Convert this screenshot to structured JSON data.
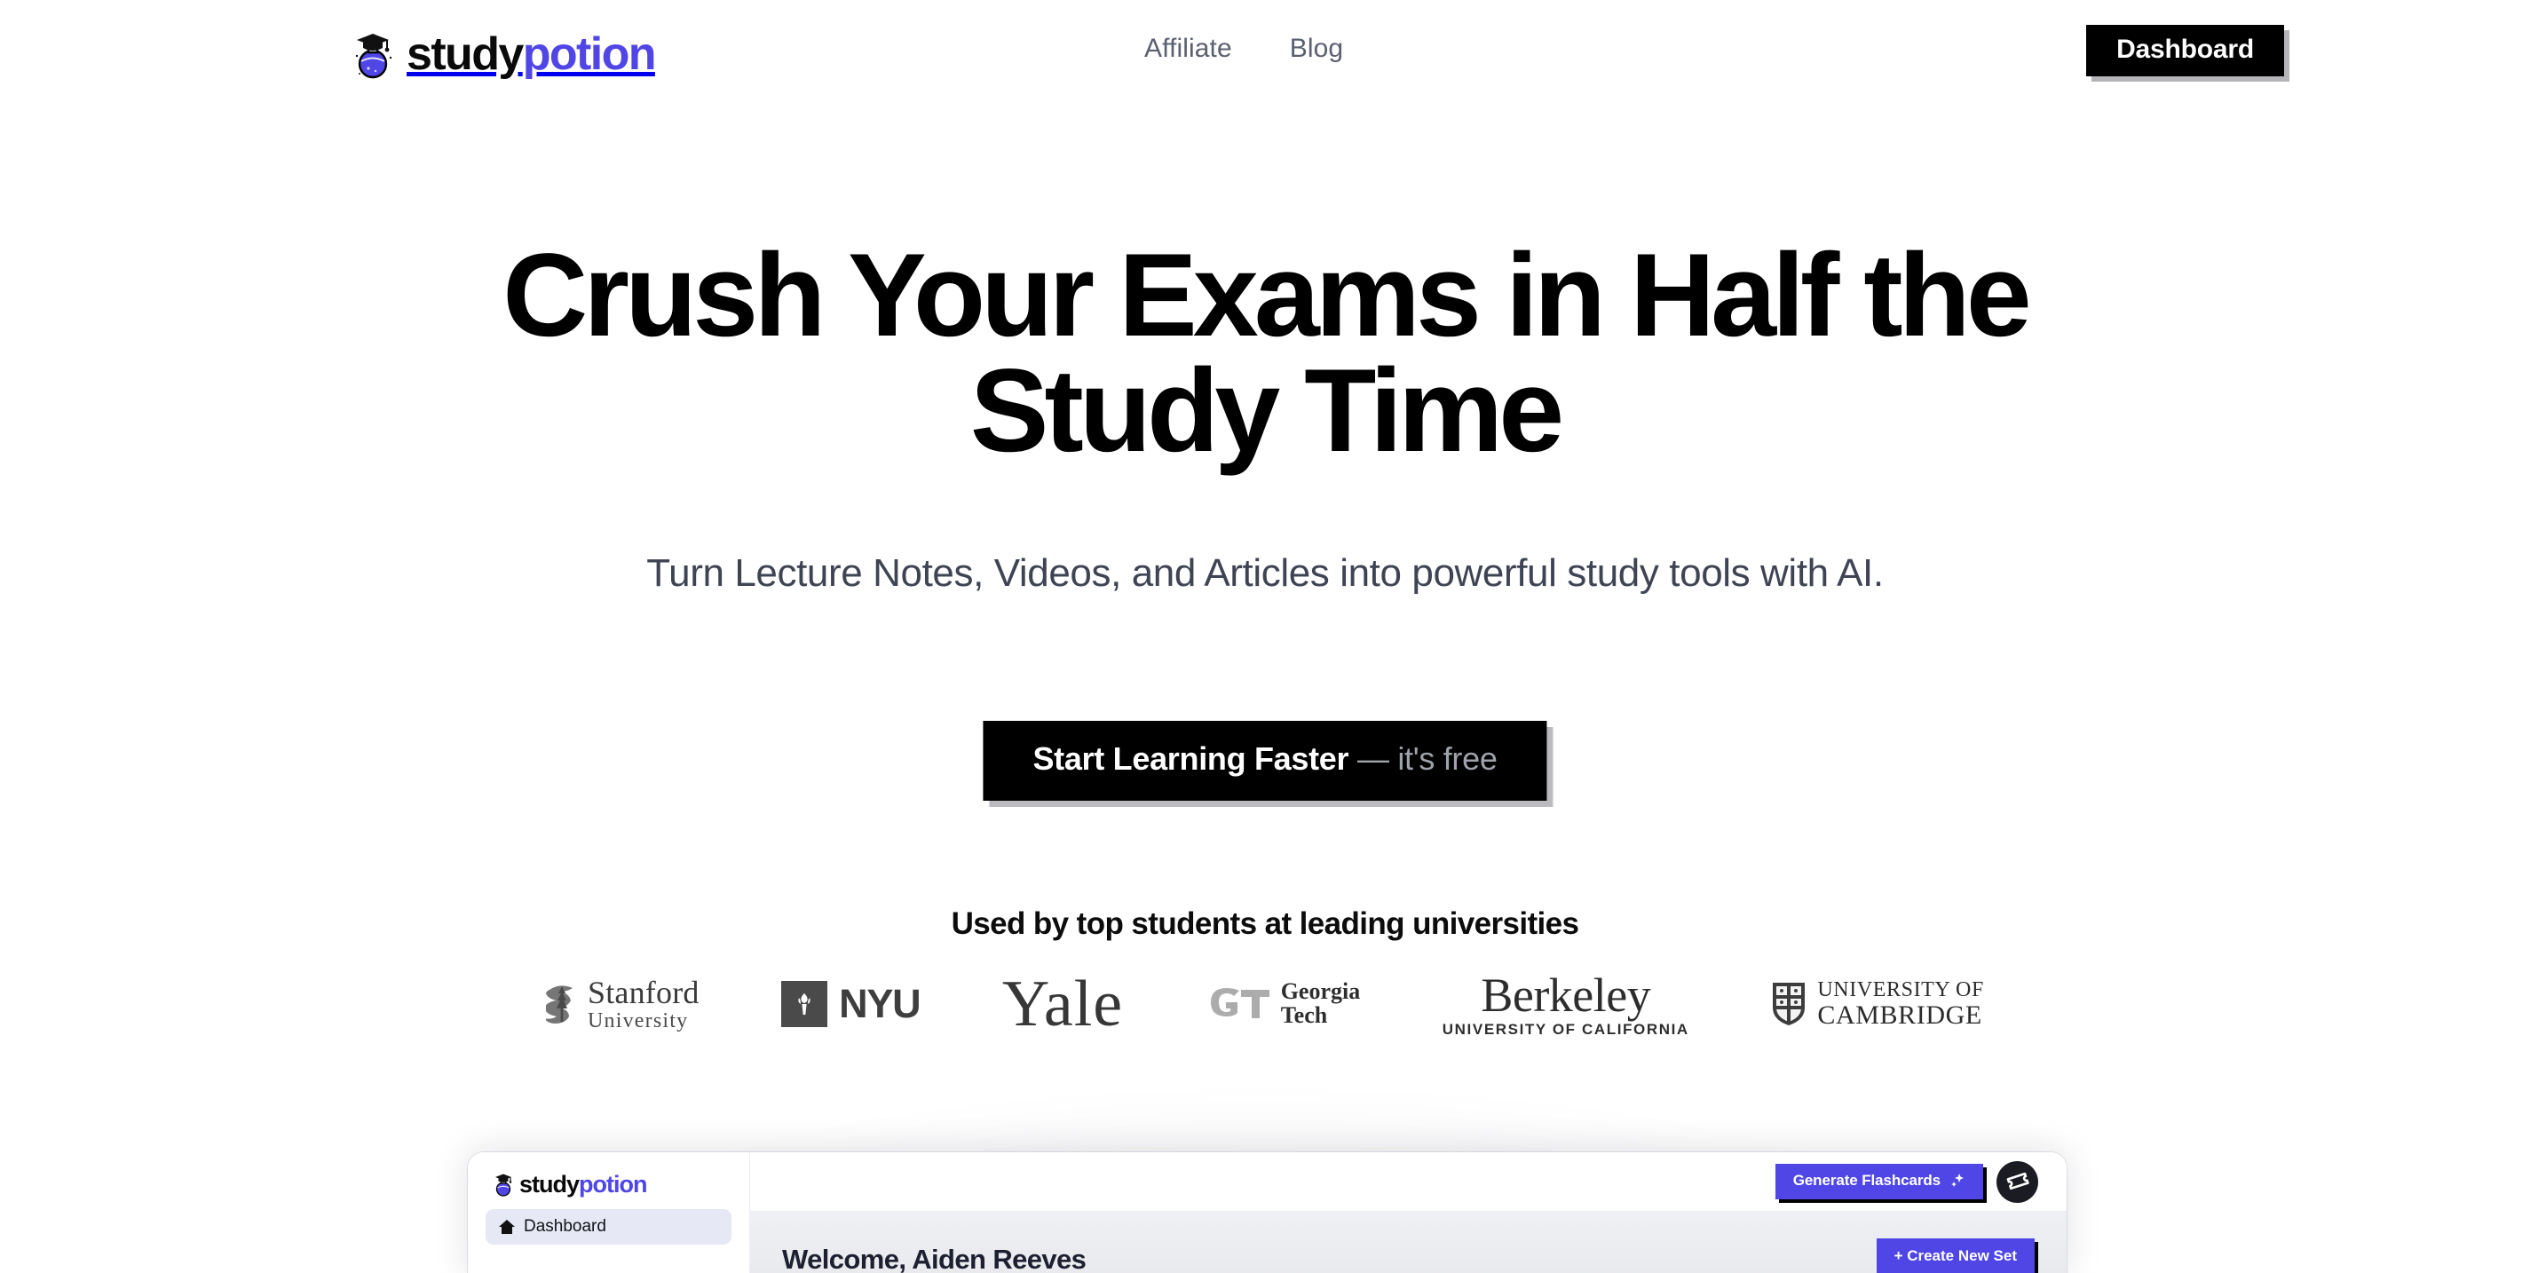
{
  "brand": {
    "name_part1": "study",
    "name_part2": "potion",
    "logo_icon": "flask-graduation-cap-icon",
    "accent_color": "#4f46e5"
  },
  "header": {
    "nav": [
      {
        "label": "Affiliate",
        "name": "nav-link-affiliate"
      },
      {
        "label": "Blog",
        "name": "nav-link-blog"
      }
    ],
    "dashboard_button": "Dashboard"
  },
  "hero": {
    "headline": "Crush Your Exams in Half the Study Time",
    "subheadline": "Turn Lecture Notes, Videos, and Articles into powerful study tools with AI.",
    "cta_primary": "Start Learning Faster",
    "cta_secondary": "— it's free"
  },
  "social_proof": {
    "title": "Used by top students at leading universities",
    "logos": [
      {
        "name": "stanford",
        "line1": "Stanford",
        "line2": "University",
        "icon": "stanford-tree-icon"
      },
      {
        "name": "nyu",
        "line1": "NYU",
        "line2": "",
        "icon": "nyu-torch-icon"
      },
      {
        "name": "yale",
        "line1": "Yale",
        "line2": "",
        "icon": ""
      },
      {
        "name": "georgia-tech",
        "line1": "Georgia",
        "line2": "Tech",
        "icon": "gt-monogram-icon"
      },
      {
        "name": "berkeley",
        "line1": "Berkeley",
        "line2": "UNIVERSITY OF CALIFORNIA",
        "icon": ""
      },
      {
        "name": "cambridge",
        "line1": "UNIVERSITY OF",
        "line2": "CAMBRIDGE",
        "icon": "cambridge-shield-icon"
      }
    ]
  },
  "dashboard_preview": {
    "sidebar": {
      "brand_part1": "study",
      "brand_part2": "potion",
      "items": [
        {
          "label": "Dashboard",
          "icon": "home-icon",
          "active": true
        }
      ]
    },
    "topbar": {
      "generate_button": "Generate Flashcards",
      "generate_icon": "sparkles-icon",
      "ticket_button_icon": "ticket-icon"
    },
    "content": {
      "welcome": "Welcome, Aiden Reeves",
      "create_button": "+ Create New Set"
    }
  }
}
